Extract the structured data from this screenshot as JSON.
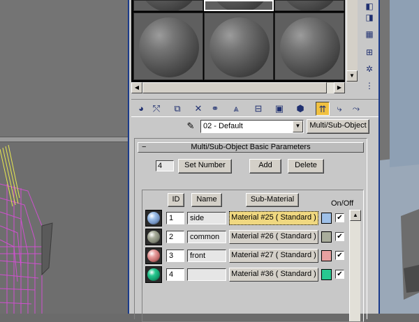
{
  "editor": {
    "material_name": "02 - Default",
    "type_button": "Multi/Sub-Object",
    "dropdown_arrow": "▼"
  },
  "scroll": {
    "up": "▲",
    "down": "▼",
    "left": "◀",
    "right": "▶"
  },
  "side_tools": [
    "sample-type-icon",
    "backlight-icon",
    "background-icon",
    "uv-tiling-icon",
    "video-check-icon",
    "make-preview-icon",
    "options-icon",
    "select-by-material-icon",
    "material-navigator-icon"
  ],
  "toolbar_tools": [
    "get-material-icon",
    "put-to-scene-icon",
    "assign-material-icon",
    "reset-map-icon",
    "make-unique-icon",
    "put-to-library-icon",
    "material-effects-icon",
    "show-map-icon",
    "show-end-result-icon",
    "go-to-parent-icon",
    "go-forward-icon"
  ],
  "rollout": {
    "collapse": "−",
    "title": "Multi/Sub-Object Basic Parameters",
    "count": "4",
    "set_number": "Set Number",
    "add": "Add",
    "delete": "Delete",
    "col_id": "ID",
    "col_name": "Name",
    "col_sub": "Sub-Material",
    "col_onoff": "On/Off"
  },
  "sub_materials": [
    {
      "id": "1",
      "name": "side",
      "material": "Material #25  ( Standard )",
      "color": "#9ec0e8",
      "ball": "#6f8fbf",
      "on": "✔"
    },
    {
      "id": "2",
      "name": "common",
      "material": "Material #26  ( Standard )",
      "color": "#a9ad9c",
      "ball": "#7f8474",
      "on": "✔"
    },
    {
      "id": "3",
      "name": "front",
      "material": "Material #27  ( Standard )",
      "color": "#e8a0a0",
      "ball": "#c06868",
      "on": "✔"
    },
    {
      "id": "4",
      "name": "",
      "material": "Material #36  ( Standard )",
      "color": "#28c890",
      "ball": "#129a6a",
      "on": "✔"
    }
  ]
}
